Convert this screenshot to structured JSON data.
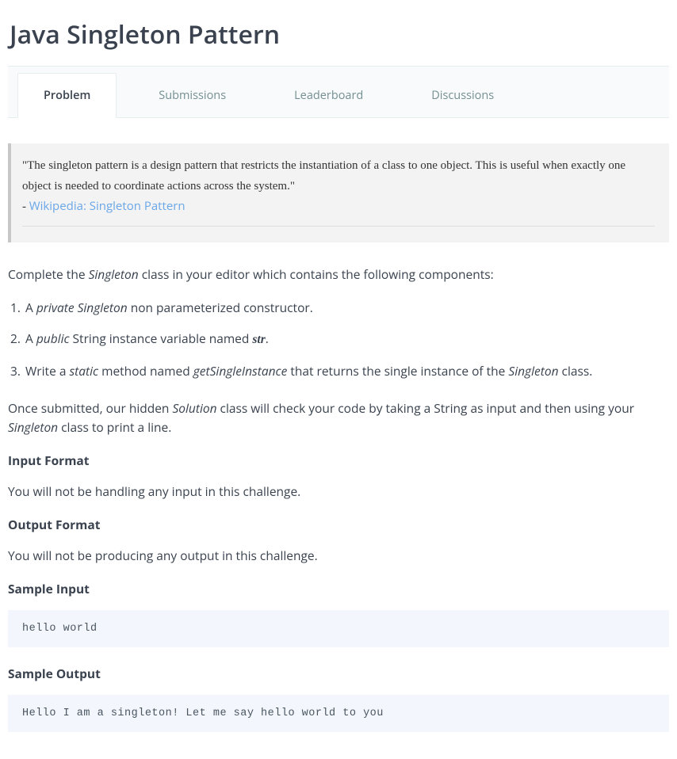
{
  "title": "Java Singleton Pattern",
  "tabs": [
    {
      "label": "Problem",
      "active": true
    },
    {
      "label": "Submissions",
      "active": false
    },
    {
      "label": "Leaderboard",
      "active": false
    },
    {
      "label": "Discussions",
      "active": false
    }
  ],
  "quote": {
    "text": "\"The singleton pattern is a design pattern that restricts the instantiation of a class to one object. This is useful when exactly one object is needed to coordinate actions across the system.\"",
    "source_prefix": "- ",
    "source_link_text": "Wikipedia: Singleton Pattern"
  },
  "intro": {
    "pre": "Complete the ",
    "italic": "Singleton",
    "post": " class in your editor which contains the following components:"
  },
  "list": [
    {
      "pre": "A ",
      "italic": "private Singleton",
      "post": " non parameterized constructor."
    },
    {
      "pre": "A ",
      "italic": "public",
      "mid": " String instance variable named ",
      "bold": "str",
      "post": "."
    },
    {
      "pre": "Write a ",
      "italic1": "static",
      "mid1": " method named ",
      "italic2": "getSingleInstance",
      "mid2": " that returns the single instance of the ",
      "italic3": "Singleton",
      "post": " class."
    }
  ],
  "outro": {
    "pre": "Once submitted, our hidden ",
    "italic1": "Solution",
    "mid": " class will check your code by taking a String as input and then using your ",
    "italic2": "Singleton",
    "post": " class to print a line."
  },
  "sections": {
    "input_format_head": "Input Format",
    "input_format_body": "You will not be handling any input in this challenge.",
    "output_format_head": "Output Format",
    "output_format_body": "You will not be producing any output in this challenge.",
    "sample_input_head": "Sample Input",
    "sample_input_code": "hello world",
    "sample_output_head": "Sample Output",
    "sample_output_code": "Hello I am a singleton! Let me say hello world to you"
  }
}
